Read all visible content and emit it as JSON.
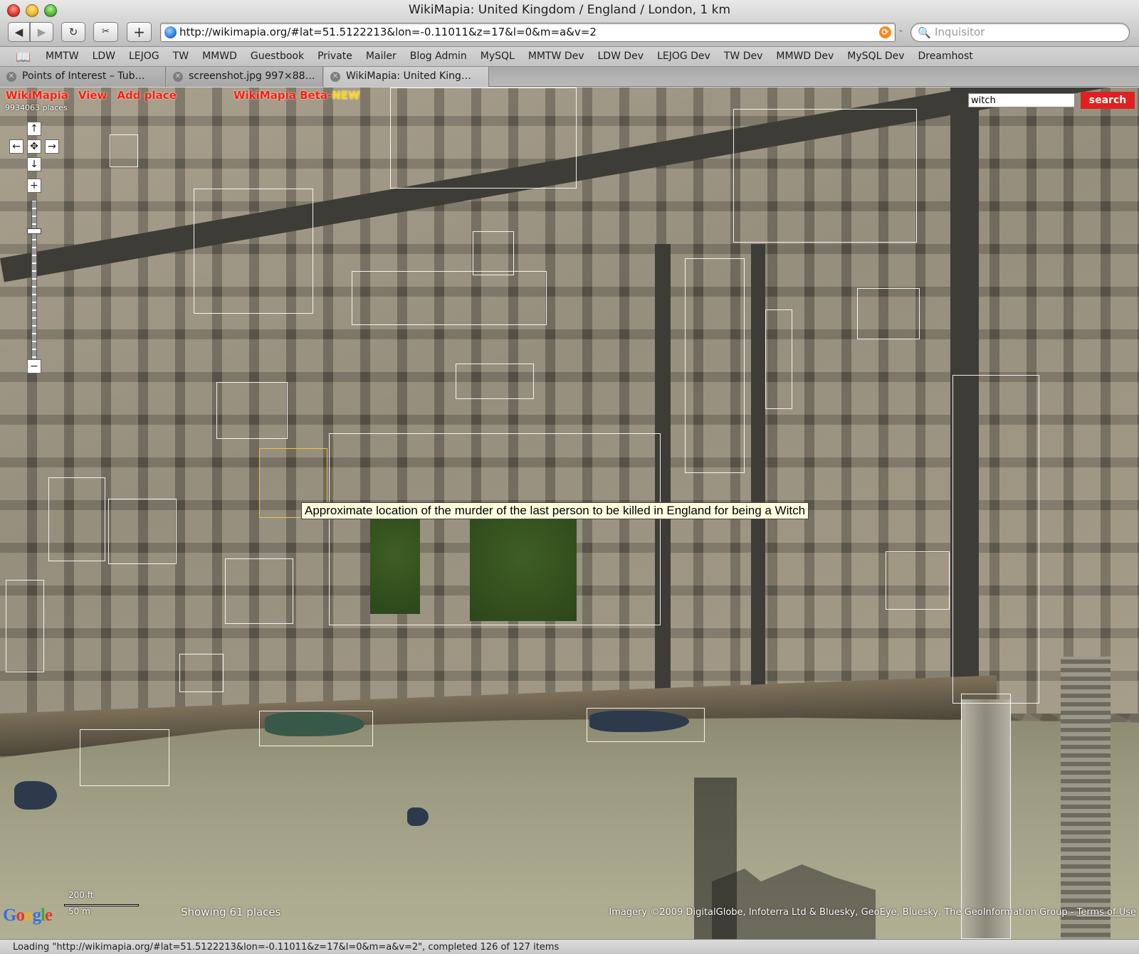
{
  "window": {
    "title": "WikiMapia: United Kingdom / England / London, 1 km"
  },
  "toolbar": {
    "back_glyph": "◀",
    "forward_glyph": "▶",
    "reload_glyph": "↻",
    "snip_glyph": "✂",
    "add_glyph": "+",
    "url": "http://wikimapia.org/#lat=51.5122213&lon=-0.11011&z=17&l=0&m=a&v=2",
    "search_placeholder": "Inquisitor",
    "search_glyph": "🔍",
    "rss_glyph": "⟳"
  },
  "bookmarks": {
    "book_glyph": "📖",
    "items": [
      "MMTW",
      "LDW",
      "LEJOG",
      "TW",
      "MMWD",
      "Guestbook",
      "Private",
      "Mailer",
      "Blog Admin",
      "MySQL",
      "MMTW Dev",
      "LDW Dev",
      "LEJOG Dev",
      "TW Dev",
      "MMWD Dev",
      "MySQL Dev",
      "Dreamhost"
    ]
  },
  "tabs": [
    {
      "title": "Points of Interest – Tub…",
      "active": false
    },
    {
      "title": "screenshot.jpg 997×88…",
      "active": false
    },
    {
      "title": "WikiMapia: United King…",
      "active": true
    }
  ],
  "map": {
    "links": [
      "WikiMapia",
      "View",
      "Add place"
    ],
    "beta_label": "WikiMapia Beta-",
    "beta_new": "NEW",
    "places_count": "9934063 places",
    "search_value": "witch",
    "search_button": "search",
    "zoom_in": "+",
    "zoom_out": "−",
    "pan_up": "↑",
    "pan_down": "↓",
    "pan_left": "←",
    "pan_right": "→",
    "pan_center": "✥",
    "tooltip": "Approximate location of the murder of the last person to be killed in England for being a Witch",
    "scale_ft": "200 ft",
    "scale_m": "50 m",
    "showing": "Showing 61 places",
    "copyright": "Imagery ©2009 DigitalGlobe, Infoterra Ltd & Bluesky, GeoEye, Bluesky, The GeoInformation Group - ",
    "terms": "Terms of Use",
    "google_letters": [
      {
        "ch": "G",
        "color": "#3a6ee8"
      },
      {
        "ch": "o",
        "color": "#e53a2a"
      },
      {
        "ch": "o",
        "color": "#f2b01e"
      },
      {
        "ch": "g",
        "color": "#3a6ee8"
      },
      {
        "ch": "l",
        "color": "#3bab3f"
      },
      {
        "ch": "e",
        "color": "#e53a2a"
      }
    ]
  },
  "status": {
    "text": "Loading \"http://wikimapia.org/#lat=51.5122213&lon=-0.11011&z=17&l=0&m=a&v=2\", completed 126 of 127 items"
  }
}
